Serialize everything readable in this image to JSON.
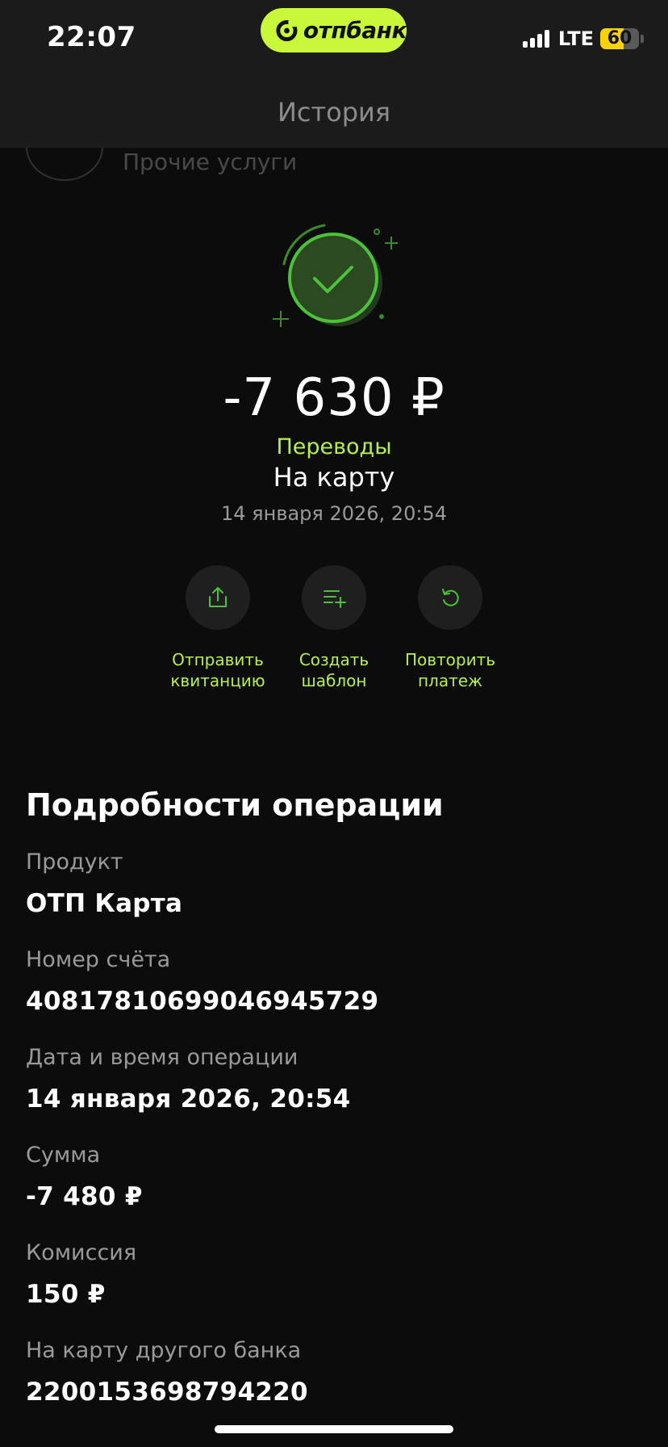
{
  "status_bar": {
    "time": "22:07",
    "network": "LTE",
    "battery_percent": "60",
    "battery_level": 0.6,
    "brand": "отпбанк",
    "brand_color": "#c9f73a"
  },
  "header": {
    "title": "История",
    "peek_item_label": "Прочие услуги"
  },
  "transaction": {
    "amount": "-7 630 ₽",
    "category": "Переводы",
    "subcategory": "На карту",
    "datetime": "14 января 2026, 20:54",
    "status_icon": "check-success-icon",
    "accent_color": "#b8f04a"
  },
  "actions": [
    {
      "line1": "Отправить",
      "line2": "квитанцию",
      "icon": "share-icon"
    },
    {
      "line1": "Создать",
      "line2": "шаблон",
      "icon": "list-add-icon"
    },
    {
      "line1": "Повторить",
      "line2": "платеж",
      "icon": "repeat-icon"
    }
  ],
  "details": {
    "title": "Подробности операции",
    "items": [
      {
        "label": "Продукт",
        "value": "ОТП Карта"
      },
      {
        "label": "Номер счёта",
        "value": "40817810699046945729"
      },
      {
        "label": "Дата и время операции",
        "value": "14 января 2026, 20:54"
      },
      {
        "label": "Сумма",
        "value": "-7 480 ₽"
      },
      {
        "label": "Комиссия",
        "value": "150 ₽"
      },
      {
        "label": "На карту другого банка",
        "value": "2200153698794220"
      }
    ]
  }
}
